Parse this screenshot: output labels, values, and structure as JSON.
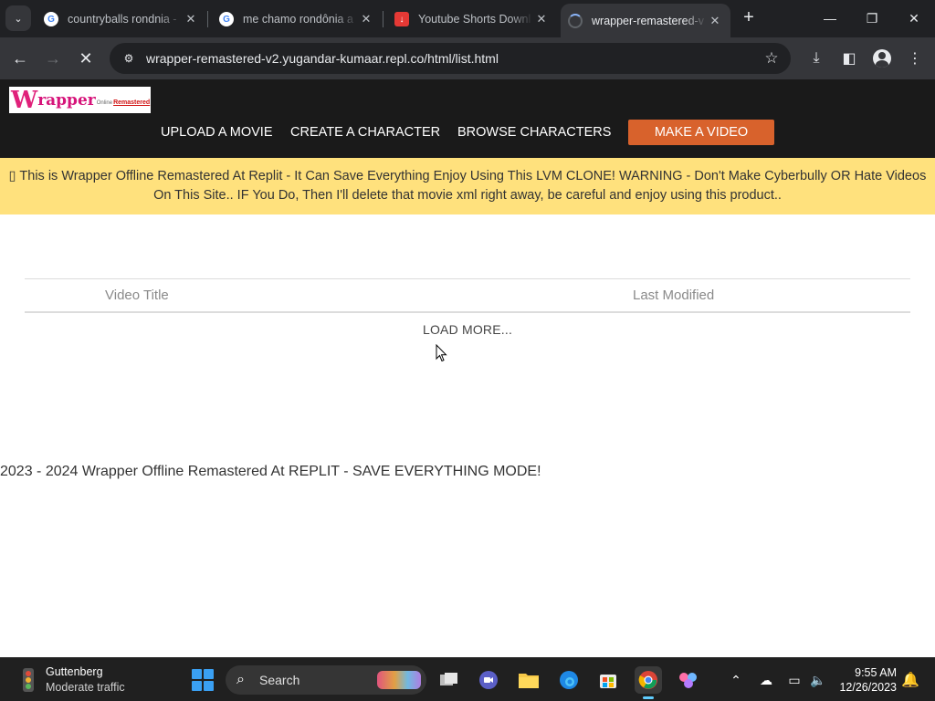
{
  "browser": {
    "tabs": [
      {
        "title": "countryballs rondnia -",
        "favicon": "google-favicon"
      },
      {
        "title": "me chamo rondônia a",
        "favicon": "google-favicon"
      },
      {
        "title": "Youtube Shorts Downl",
        "favicon": "download-favicon"
      },
      {
        "title": "wrapper-remastered-v",
        "favicon": "loading-spinner"
      }
    ],
    "url": "wrapper-remastered-v2.yugandar-kumaar.repl.co/html/list.html"
  },
  "site": {
    "logo": {
      "big": "W",
      "mid": "rapper",
      "small1": "Online",
      "small2": "Remastered"
    },
    "nav": {
      "upload": "UPLOAD A MOVIE",
      "create": "CREATE A CHARACTER",
      "browse": "BROWSE CHARACTERS",
      "make": "MAKE A VIDEO"
    },
    "banner": "▯ This is Wrapper Offline Remastered At Replit - It Can Save Everything Enjoy Using This LVM CLONE! WARNING - Don't Make Cyberbully OR Hate Videos On This Site.. IF You Do, Then I'll delete that movie xml right away, be careful and enjoy using this product..",
    "table": {
      "col_title": "Video Title",
      "col_modified": "Last Modified",
      "load_more": "LOAD MORE..."
    },
    "footer": "2023 - 2024 Wrapper Offline Remastered At REPLIT - SAVE EVERYTHING MODE!"
  },
  "taskbar": {
    "weather_title": "Guttenberg",
    "weather_sub": "Moderate traffic",
    "search_label": "Search",
    "time": "9:55 AM",
    "date": "12/26/2023"
  },
  "colors": {
    "header_bg": "#1a1a1a",
    "accent_button": "#d8622c",
    "banner_bg": "#ffe17d"
  }
}
